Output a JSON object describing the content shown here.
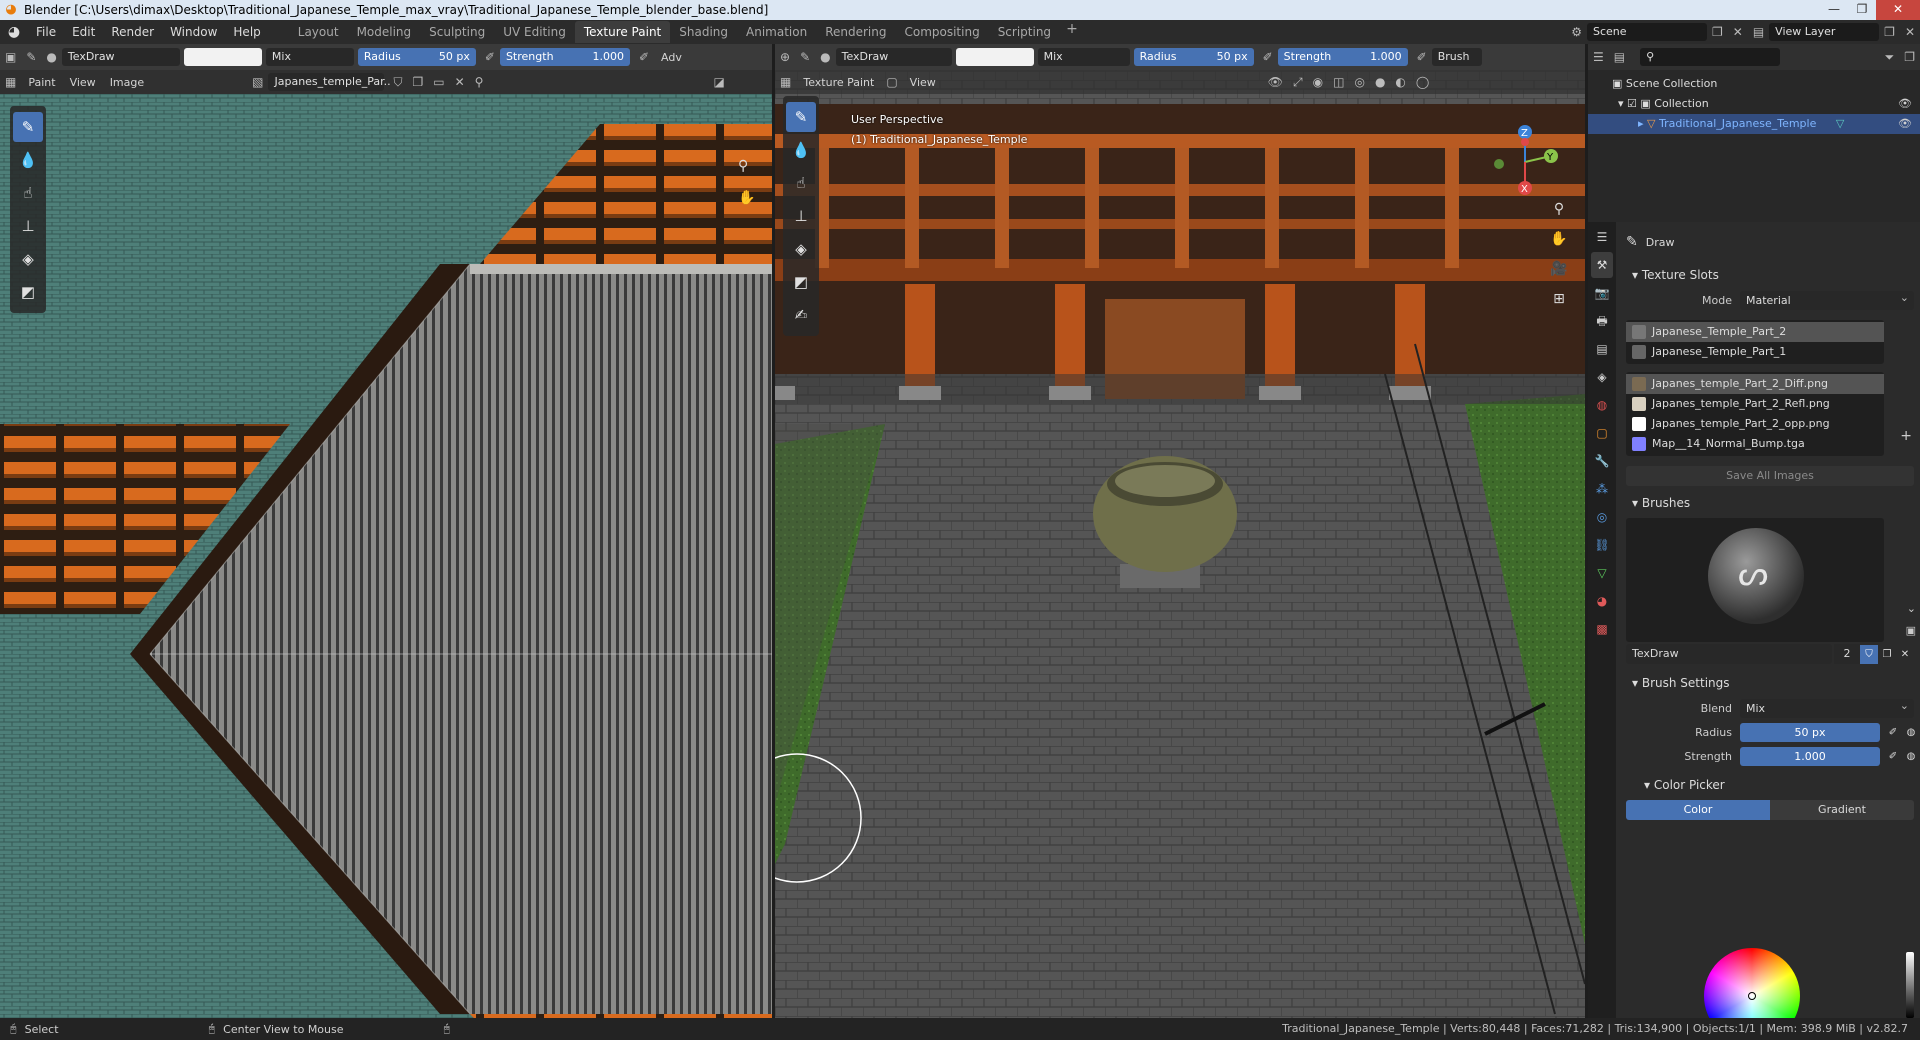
{
  "window": {
    "title": "Blender [C:\\Users\\dimax\\Desktop\\Traditional_Japanese_Temple_max_vray\\Traditional_Japanese_Temple_blender_base.blend]"
  },
  "menu": [
    "File",
    "Edit",
    "Render",
    "Window",
    "Help"
  ],
  "workspaces": [
    "Layout",
    "Modeling",
    "Sculpting",
    "UV Editing",
    "Texture Paint",
    "Shading",
    "Animation",
    "Rendering",
    "Compositing",
    "Scripting"
  ],
  "active_workspace": "Texture Paint",
  "scene": "Scene",
  "view_layer": "View Layer",
  "image_editor": {
    "brush": "TexDraw",
    "blend": "Mix",
    "radius_label": "Radius",
    "radius_value": "50 px",
    "strength_label": "Strength",
    "strength_value": "1.000",
    "adv": "Adv",
    "mode": "Paint",
    "view": "View",
    "image": "Image",
    "image_name": "Japanes_temple_Par.."
  },
  "viewport": {
    "brush": "TexDraw",
    "blend": "Mix",
    "radius_label": "Radius",
    "radius_value": "50 px",
    "strength_label": "Strength",
    "strength_value": "1.000",
    "brush_menu": "Brush",
    "mode": "Texture Paint",
    "view": "View",
    "perspective": "User Perspective",
    "object": "(1) Traditional_Japanese_Temple"
  },
  "outliner": {
    "root": "Scene Collection",
    "collection": "Collection",
    "object": "Traditional_Japanese_Temple"
  },
  "properties": {
    "tool_name": "Draw",
    "texture_slots": {
      "title": "Texture Slots",
      "mode_label": "Mode",
      "mode_value": "Material",
      "materials": [
        "Japanese_Temple_Part_2",
        "Japanese_Temple_Part_1"
      ],
      "images": [
        {
          "name": "Japanes_temple_Part_2_Diff.png",
          "color": "#7a6a52"
        },
        {
          "name": "Japanes_temple_Part_2_Refl.png",
          "color": "#d8d0c0"
        },
        {
          "name": "Japanes_temple_Part_2_opp.png",
          "color": "#ffffff"
        },
        {
          "name": "Map__14_Normal_Bump.tga",
          "color": "#8080ff"
        }
      ],
      "save_all": "Save All Images"
    },
    "brushes": {
      "title": "Brushes",
      "name": "TexDraw",
      "users": "2"
    },
    "brush_settings": {
      "title": "Brush Settings",
      "blend_label": "Blend",
      "blend_value": "Mix",
      "radius_label": "Radius",
      "radius_value": "50 px",
      "strength_label": "Strength",
      "strength_value": "1.000"
    },
    "color_picker": {
      "title": "Color Picker",
      "tab_color": "Color",
      "tab_gradient": "Gradient"
    }
  },
  "status": {
    "select": "Select",
    "center": "Center View to Mouse",
    "stats": "Traditional_Japanese_Temple | Verts:80,448 | Faces:71,282 | Tris:134,900 | Objects:1/1 | Mem: 398.9 MiB | v2.82.7"
  }
}
